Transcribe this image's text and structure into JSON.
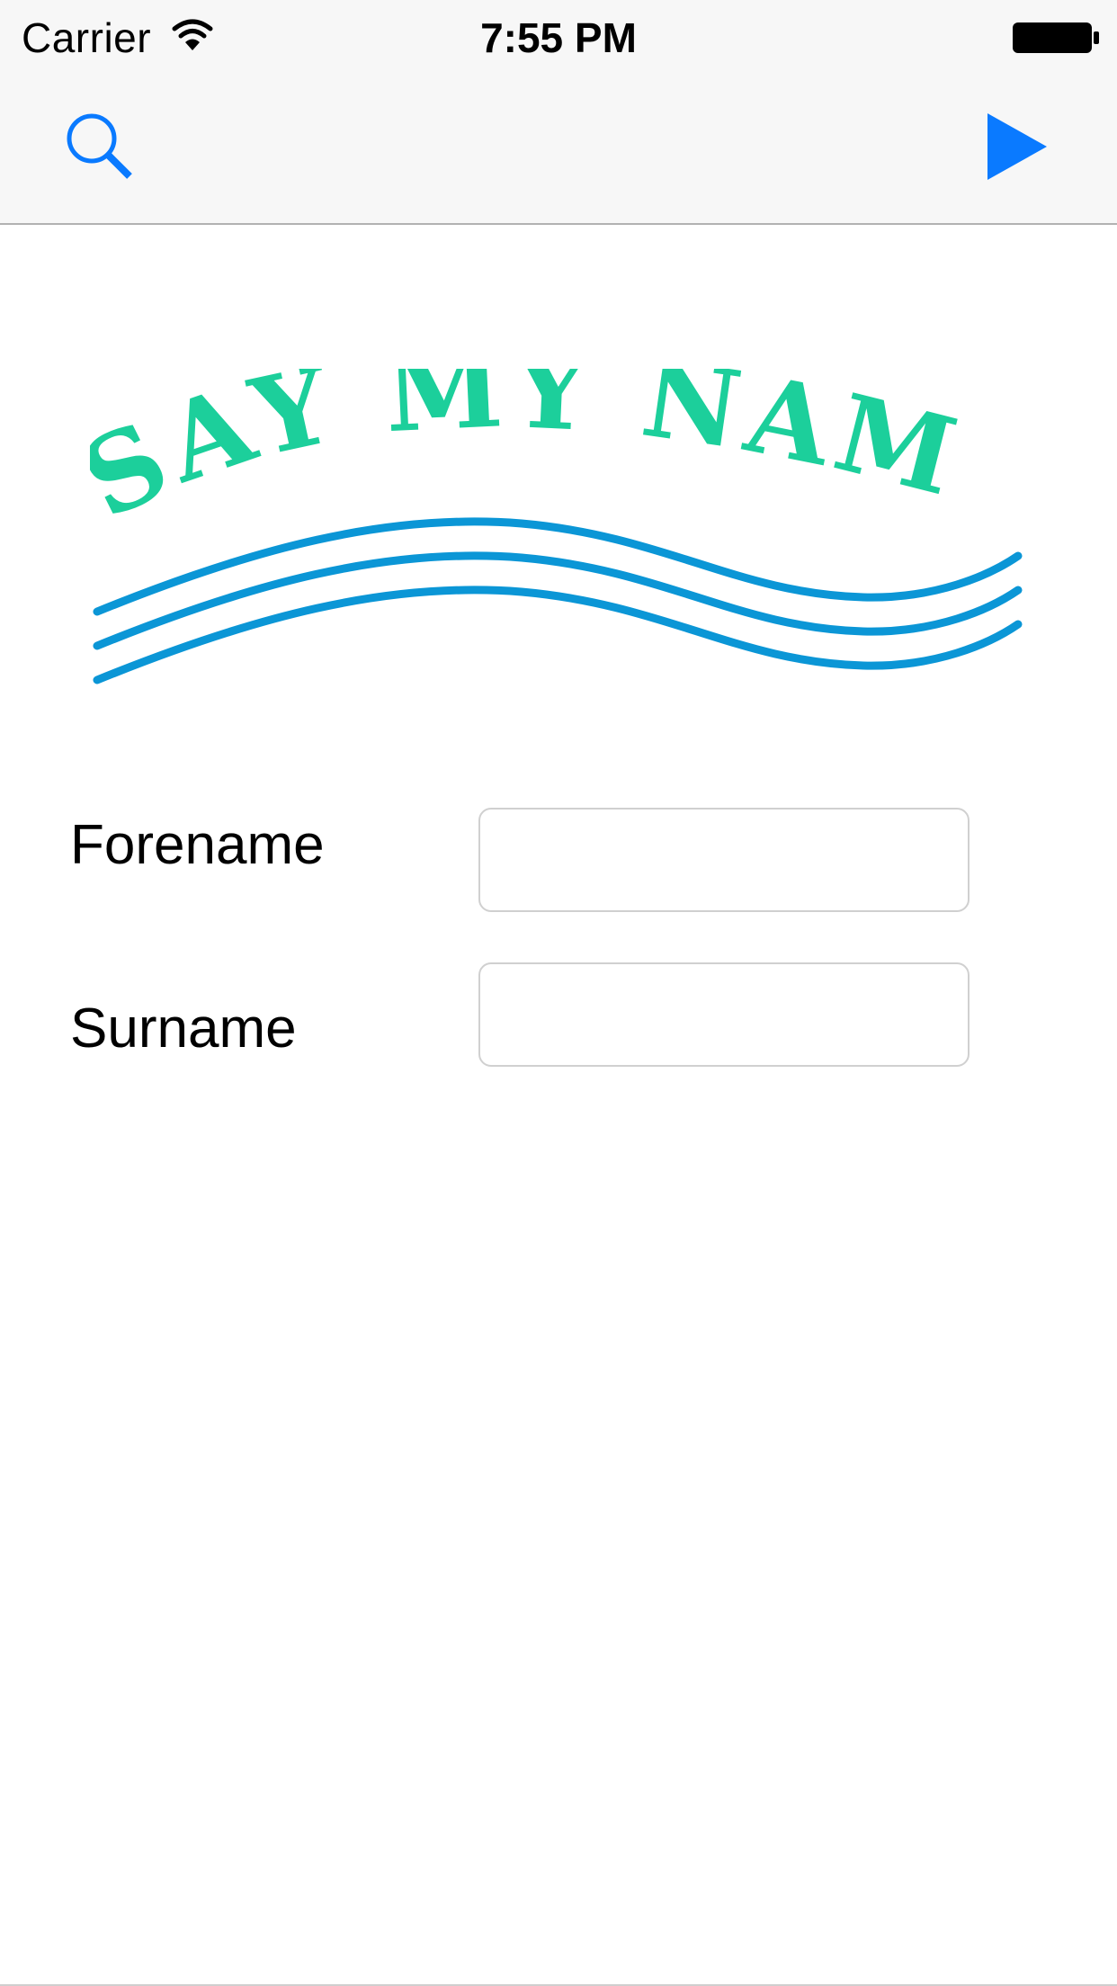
{
  "status_bar": {
    "carrier": "Carrier",
    "time": "7:55 PM",
    "wifi_icon": "wifi-icon",
    "battery_icon": "battery-icon"
  },
  "nav_bar": {
    "left_icon": "search-icon",
    "right_icon": "play-icon",
    "tint_color": "#0a7aff"
  },
  "logo": {
    "text": "SAY MY NAME",
    "letter_color": "#1ccf9b",
    "wave_color": "#0b96d6"
  },
  "form": {
    "forename_label": "Forename",
    "forename_value": "",
    "surname_label": "Surname",
    "surname_value": ""
  }
}
